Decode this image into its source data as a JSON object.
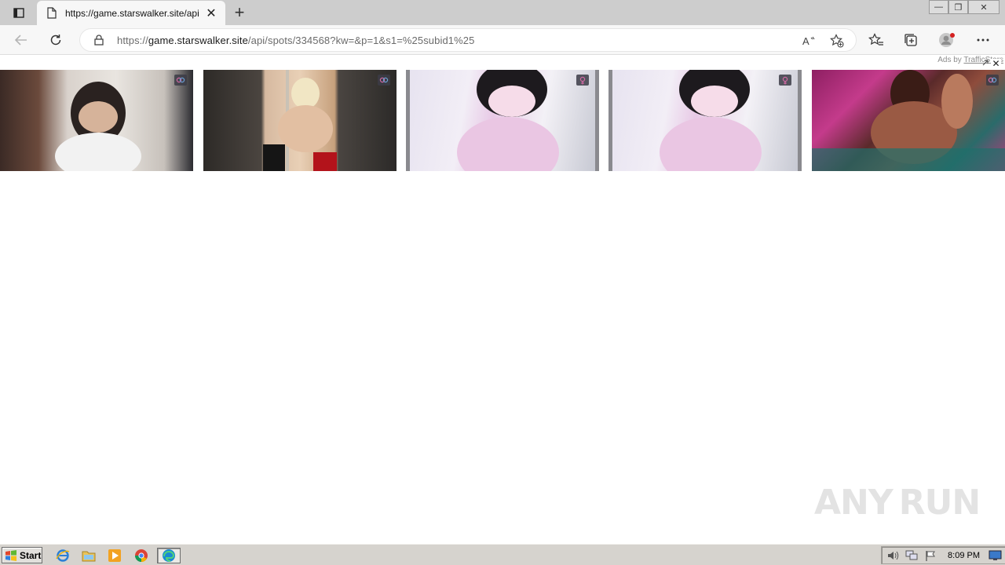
{
  "browser": {
    "tab": {
      "title": "https://game.starswalker.site/api",
      "close_glyph": "✕",
      "icon": "page-icon"
    },
    "new_tab_glyph": "+",
    "window_controls": {
      "minimize": "—",
      "restore": "❐",
      "close": "✕"
    },
    "address": {
      "url_prefix": "https://",
      "url_domain": "game.starswalker.site",
      "url_path": "/api/spots/334568?kw=&p=1&s1=%25subid1%25"
    },
    "toolbar_icons": [
      "back-icon",
      "refresh-icon",
      "lock-icon",
      "read-aloud-icon",
      "add-favorite-icon",
      "favorites-icon",
      "collections-icon",
      "profile-icon",
      "more-icon"
    ]
  },
  "page": {
    "ads_label": "Ads by",
    "ads_link": "TrafficStars",
    "ad_close_glyph": "✕",
    "thumbnails": [
      {
        "id": "thumb-1",
        "badge_icon": "gender-icon"
      },
      {
        "id": "thumb-2",
        "badge_icon": "gender-icon"
      },
      {
        "id": "thumb-3",
        "badge_icon": "female-icon"
      },
      {
        "id": "thumb-4",
        "badge_icon": "female-icon"
      },
      {
        "id": "thumb-5",
        "badge_icon": "gender-icon"
      }
    ],
    "watermark": {
      "left": "ANY",
      "right": "RUN"
    }
  },
  "taskbar": {
    "start_label": "Start",
    "pinned_icons": [
      "internet-explorer-icon",
      "file-explorer-icon",
      "media-player-icon",
      "chrome-icon",
      "edge-icon"
    ],
    "tray_icons": [
      "volume-icon",
      "network-icon",
      "flag-icon"
    ],
    "clock": "8:09 PM"
  },
  "colors": {
    "tabbar_bg": "#cdcdcd",
    "toolbar_bg": "#f7f7f7",
    "taskbar_bg": "#d6d3ce"
  }
}
